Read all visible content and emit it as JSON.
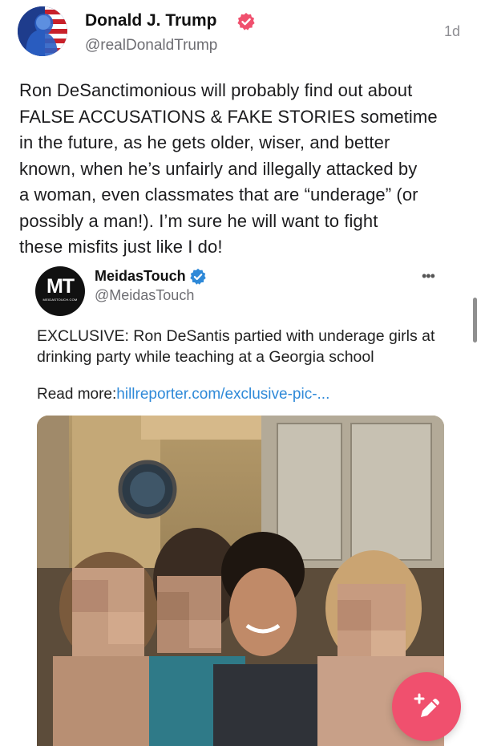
{
  "post": {
    "author_name": "Donald J. Trump",
    "author_handle": "@realDonaldTrump",
    "timestamp": "1d",
    "text": "Ron DeSanctimonious will probably find out about\nFALSE ACCUSATIONS & FAKE STORIES sometime\nin the future, as he gets older, wiser, and better\nknown, when he’s unfairly and illegally attacked by\na woman, even classmates that are “underage” (or\npossibly a man!). I’m sure he will want to fight\nthese misfits just like I do!"
  },
  "embed": {
    "logo_text": "MT",
    "logo_subtext": "MEIDASTOUCH.COM",
    "author_name": "MeidasTouch",
    "author_handle": "@MeidasTouch",
    "menu_label": "•••",
    "text": "EXCLUSIVE: Ron DeSantis partied with underage girls at drinking party while teaching at a Georgia school",
    "read_more_label": "Read more:",
    "read_more_link": "hillreporter.com/exclusive-pic-..."
  },
  "colors": {
    "verified_pink": "#f0506e",
    "verified_blue": "#2e89d8",
    "link": "#2e89d8",
    "fab": "#f0506e"
  },
  "icons": {
    "verified_badge": "verified-badge-icon",
    "compose": "compose-pencil-icon"
  }
}
